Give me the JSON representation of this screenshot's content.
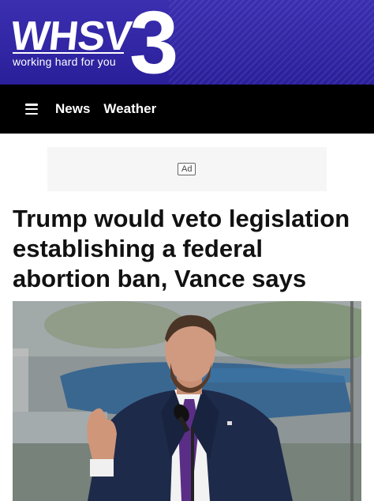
{
  "brand": {
    "call_letters": "WHSV",
    "channel_number": "3",
    "tagline": "working hard for you",
    "background_color": "#2f24a4"
  },
  "nav": {
    "menu_icon": "hamburger-menu-icon",
    "items": [
      {
        "label": "News"
      },
      {
        "label": "Weather"
      }
    ]
  },
  "ad": {
    "label": "Ad"
  },
  "article": {
    "headline": "Trump would veto legislation establishing a federal abortion ban, Vance says"
  }
}
